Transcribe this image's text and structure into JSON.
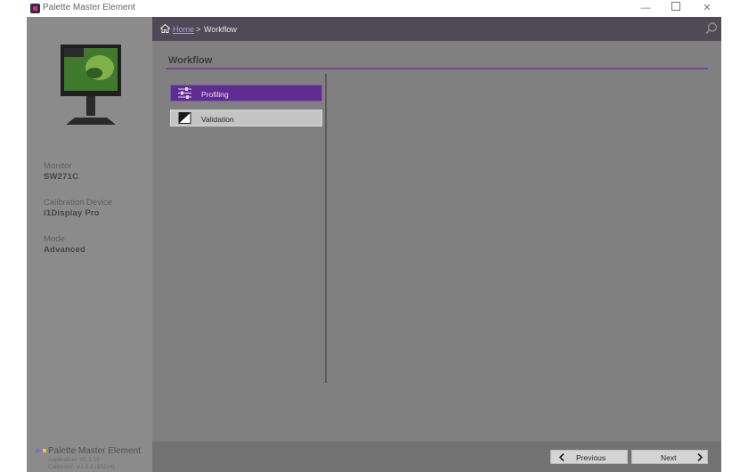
{
  "window": {
    "title": "Palette Master Element",
    "minimize": "—",
    "maximize": "",
    "close": "✕"
  },
  "sidebar": {
    "monitor": {
      "label": "Monitor",
      "value": "SW271C"
    },
    "device": {
      "label": "Calibration Device",
      "value": "i1Display Pro"
    },
    "mode": {
      "label": "Mode",
      "value": "Advanced"
    },
    "footer": {
      "app_name": "Palette Master Element",
      "app_version": "Application: V1.3.15",
      "calibrator_version": "Calibrator: V1.3.2 (10204)"
    }
  },
  "breadcrumb": {
    "home": "Home",
    "separator": ">",
    "current": "Workflow"
  },
  "section": {
    "title": "Workflow"
  },
  "workflow_items": [
    {
      "label": "Profiling",
      "icon": "sliders-icon",
      "selected": true
    },
    {
      "label": "Validation",
      "icon": "contrast-icon",
      "selected": false
    }
  ],
  "navigation": {
    "previous": "Previous",
    "next": "Next"
  },
  "colors": {
    "accent": "#5f2d91",
    "sidebar_bg": "#8b8b8b",
    "main_bg": "#808080",
    "header_bg": "#4f4a56"
  }
}
